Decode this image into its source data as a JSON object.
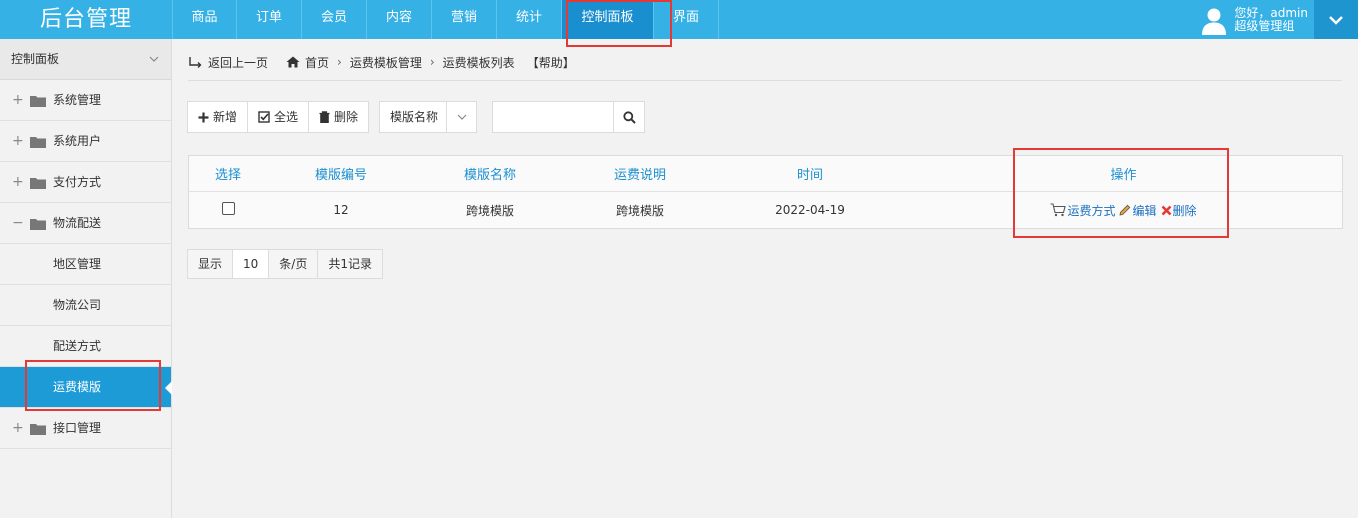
{
  "app": {
    "title": "后台管理"
  },
  "nav": [
    {
      "label": "商品",
      "active": false
    },
    {
      "label": "订单",
      "active": false
    },
    {
      "label": "会员",
      "active": false
    },
    {
      "label": "内容",
      "active": false
    },
    {
      "label": "营销",
      "active": false
    },
    {
      "label": "统计",
      "active": false
    },
    {
      "label": "控制面板",
      "active": true
    },
    {
      "label": "界面",
      "active": false
    }
  ],
  "user": {
    "greeting": "您好，admin",
    "role": "超级管理组"
  },
  "sidebar": {
    "header": "控制面板",
    "items": [
      {
        "label": "系统管理"
      },
      {
        "label": "系统用户"
      },
      {
        "label": "支付方式"
      },
      {
        "label": "物流配送"
      },
      {
        "label": "地区管理"
      },
      {
        "label": "物流公司"
      },
      {
        "label": "配送方式"
      },
      {
        "label": "运费模版"
      },
      {
        "label": "接口管理"
      }
    ]
  },
  "breadcrumb": {
    "back": "返回上一页",
    "home": "首页",
    "level1": "运费模板管理",
    "level2": "运费模板列表",
    "help": "【帮助】"
  },
  "toolbar": {
    "add": "新增",
    "select_all": "全选",
    "delete": "删除"
  },
  "filter": {
    "field": "模版名称",
    "search_value": ""
  },
  "table": {
    "headers": [
      "选择",
      "模版编号",
      "模版名称",
      "运费说明",
      "时间",
      "操作"
    ],
    "rows": [
      {
        "id": "12",
        "name": "跨境模版",
        "desc": "跨境模版",
        "time": "2022-04-19"
      }
    ],
    "actions": {
      "shipping": "运费方式",
      "edit": "编辑",
      "delete": "删除"
    }
  },
  "pager": {
    "show": "显示",
    "page_size": "10",
    "per_page": "条/页",
    "total": "共1记录"
  },
  "colors": {
    "topbar": "#35b1e6",
    "active": "#1d9bd7",
    "header_text": "#1b8fd0",
    "highlight": "#e53935"
  }
}
